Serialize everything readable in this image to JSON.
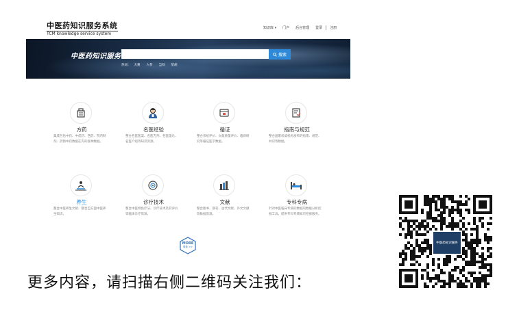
{
  "logo": {
    "cn": "中医药知识服务系统",
    "en": "TCM knowledge service system"
  },
  "topnav": {
    "items": [
      "知识库 ▾",
      "门户",
      "后台管理",
      "登录",
      "注册"
    ]
  },
  "banner": {
    "title": "中医药知识服务",
    "search_placeholder": "",
    "search_button": "搜索",
    "hot_words": [
      "热词：",
      "大黄",
      "人参",
      "当归",
      "柴胡"
    ]
  },
  "cards": [
    {
      "title": "方药",
      "desc": "集成包括中药、中成药、西药、院内制剂、药物中药数据在内的各种数据。",
      "icon": "medicine-box-icon"
    },
    {
      "title": "名医经验",
      "desc": "整合名医医案、名医方剂、名医理论、名医介绍等知识资源。",
      "icon": "doctor-icon"
    },
    {
      "title": "循证",
      "desc": "整合系统评价、文献质量评价、临床研究等循证医学数据。",
      "icon": "evidence-icon"
    },
    {
      "title": "指南与规范",
      "desc": "整合国家权威机构发布的指南、规范、共识等数据。",
      "icon": "guideline-icon"
    },
    {
      "title": "养生",
      "desc": "整合中医养生文献、整合自方面中医养生知识。",
      "icon": "health-care-icon"
    },
    {
      "title": "诊疗技术",
      "desc": "整合中医特色疗法、诊疗技术及其评价等临床诊疗资源。",
      "icon": "diagnosis-icon"
    },
    {
      "title": "文献",
      "desc": "整合图书、期刊、古代文献、外文文献等数据资源。",
      "icon": "books-icon"
    },
    {
      "title": "专科专病",
      "desc": "针对中医临床专病的数据的数据分析挖掘工具，提供专科专病知识挖掘服务。",
      "icon": "bed-icon"
    }
  ],
  "more": {
    "label": "MORE",
    "sub": "更多 >>"
  },
  "bottom_text": "更多内容，请扫描右侧二维码关注我们：",
  "qr": {
    "center_label": "中医药知识服务"
  },
  "colors": {
    "accent": "#2e8ad8",
    "text_dark": "#333333",
    "desc_gray": "#8a8a8a"
  }
}
